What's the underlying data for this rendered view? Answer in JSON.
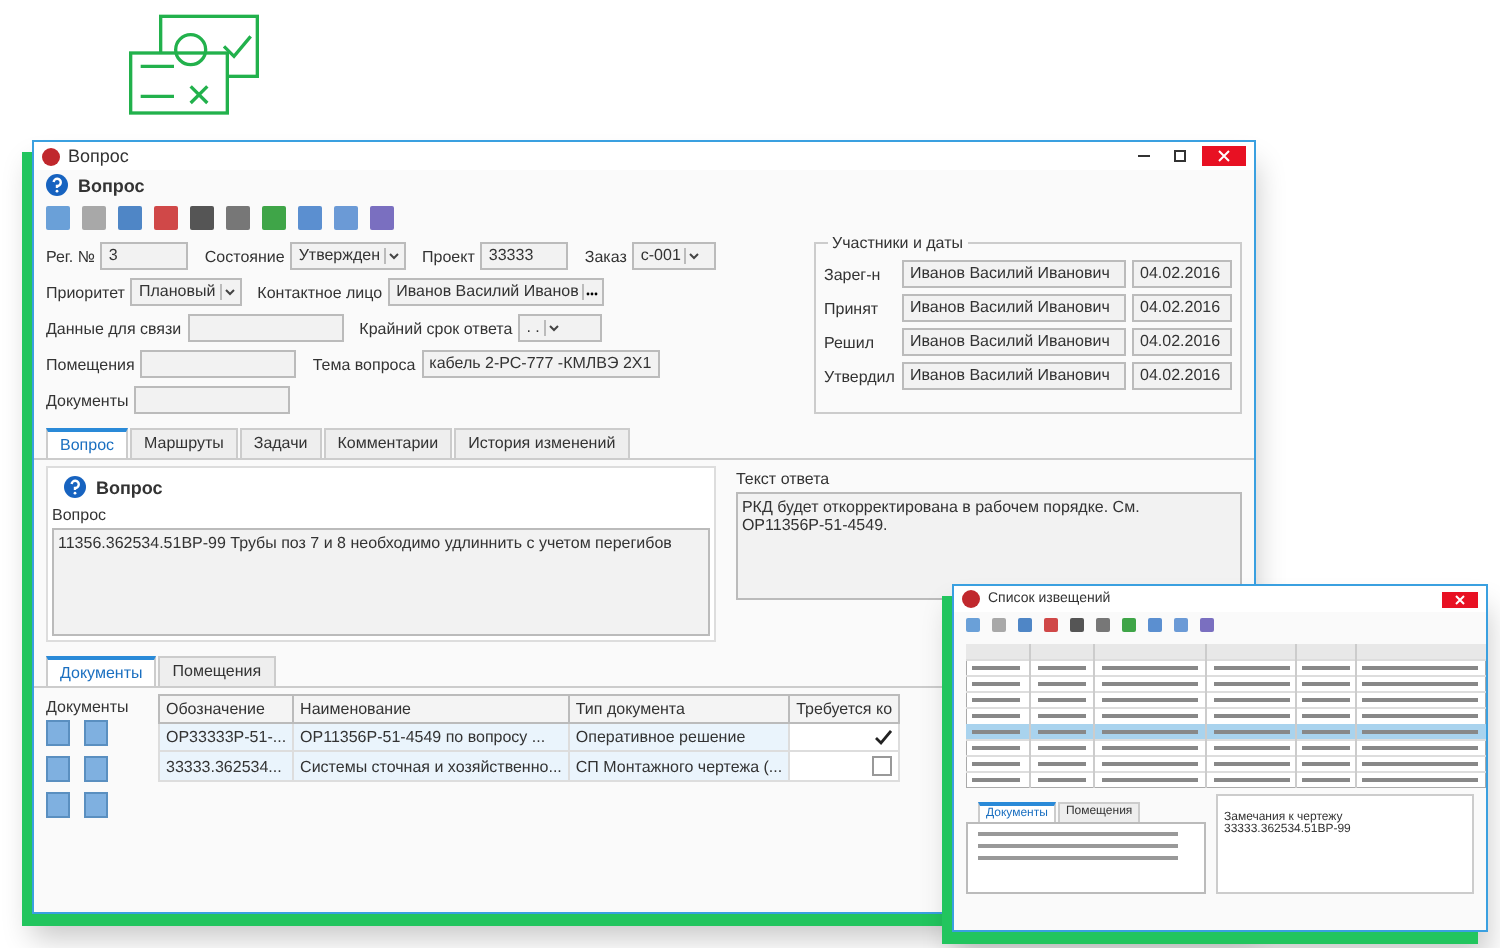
{
  "main_window": {
    "title": "Вопрос",
    "header": "Вопрос",
    "fields": [
      {
        "label": "Рег. №",
        "value": "3",
        "kind": "text"
      },
      {
        "label": "Состояние",
        "value": "Утвержден",
        "kind": "select"
      },
      {
        "label": "Проект",
        "value": "33333",
        "kind": "text"
      },
      {
        "label": "Заказ",
        "value": "с-001",
        "kind": "select"
      },
      {
        "label": "Приоритет",
        "value": "Плановый",
        "kind": "select"
      },
      {
        "label": "Контактное лицо",
        "value": "Иванов Василий Иванов",
        "kind": "lookup"
      },
      {
        "label": "Данные для связи",
        "kind": "text"
      },
      {
        "label": "Крайний срок ответа",
        "value": ". .",
        "kind": "select"
      },
      {
        "label": "Помещения",
        "kind": "text"
      },
      {
        "label": "Тема вопроса",
        "value": "кабель 2-РС-777 -КМЛВЭ 2Х1",
        "kind": "text"
      },
      {
        "label": "Документы",
        "kind": "text"
      }
    ],
    "participants": {
      "title": "Участники и даты",
      "rows": [
        {
          "role": "Зарег-н",
          "person": "Иванов Василий Иванович",
          "date": "04.02.2016"
        },
        {
          "role": "Принят",
          "person": "Иванов Василий Иванович",
          "date": "04.02.2016"
        },
        {
          "role": "Решил",
          "person": "Иванов Василий Иванович",
          "date": "04.02.2016"
        },
        {
          "role": "Утвердил",
          "person": "Иванов Василий Иванович",
          "date": "04.02.2016"
        }
      ]
    },
    "tabs": [
      {
        "label": "Вопрос",
        "selected": true
      },
      {
        "label": "Маршруты",
        "selected": false
      },
      {
        "label": "Задачи",
        "selected": false
      },
      {
        "label": "Комментарии",
        "selected": false
      },
      {
        "label": "История изменений",
        "selected": false
      }
    ],
    "question": {
      "header": "Вопрос",
      "label": "Вопрос",
      "value": "11356.362534.51ВР-99 Трубы поз 7 и 8 необходимо удлиннить с учетом перегибов"
    },
    "answer": {
      "label": "Текст ответа",
      "value": "РКД будет откорректирована в рабочем порядке. См. ОР11356Р-51-4549."
    },
    "bottom_tabs": [
      {
        "label": "Документы",
        "selected": true
      },
      {
        "label": "Помещения",
        "selected": false
      }
    ],
    "documents": {
      "label": "Документы",
      "columns": [
        "Обозначение",
        "Наименование",
        "Тип документа",
        "Требуется ко"
      ],
      "rows": [
        {
          "cells": [
            "ОР33333Р-51-...",
            "ОР11356Р-51-4549  по вопросу ...",
            "Оперативное решение"
          ],
          "checked": true
        },
        {
          "cells": [
            "33333.362534...",
            "Системы сточная и хозяйственно...",
            "СП Монтажного чертежа (..."
          ],
          "checked": false
        }
      ]
    }
  },
  "list_window": {
    "title": "Список извещений",
    "comment": "Замечания к чертежу 33333.362534.51ВР-99",
    "bottom_tabs": [
      {
        "label": "Документы",
        "selected": true
      },
      {
        "label": "Помещения",
        "selected": false
      }
    ]
  }
}
